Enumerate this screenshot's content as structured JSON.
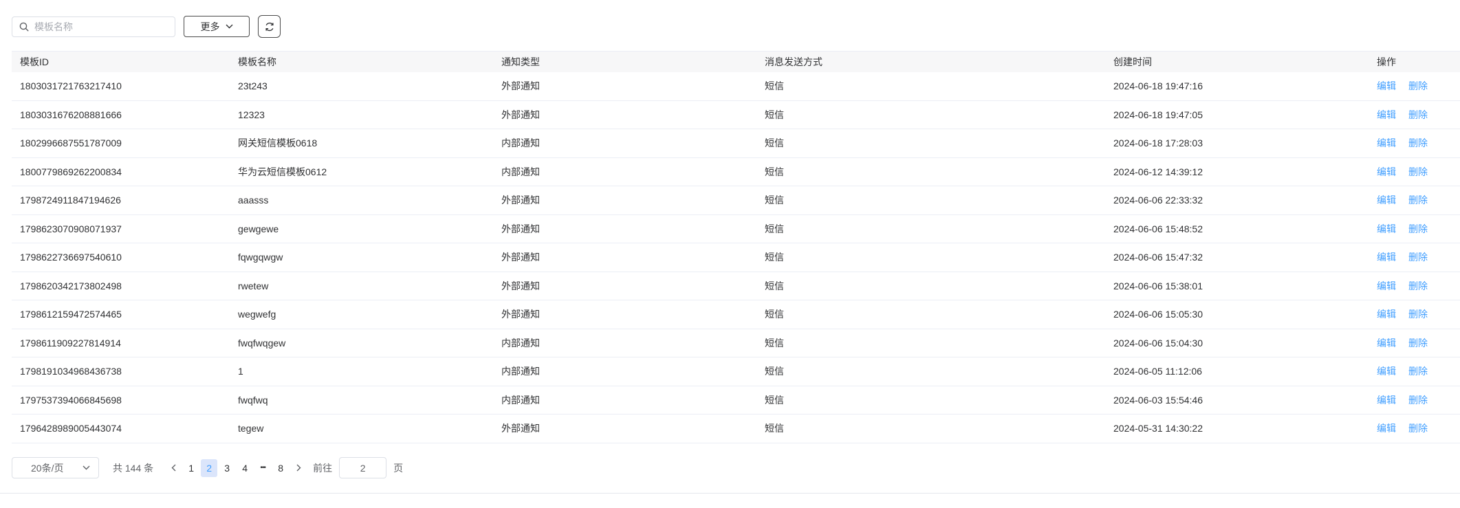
{
  "toolbar": {
    "search_placeholder": "模板名称",
    "more_label": "更多"
  },
  "table": {
    "columns": [
      "模板ID",
      "模板名称",
      "通知类型",
      "消息发送方式",
      "创建时间",
      "操作"
    ],
    "rows": [
      {
        "id": "1803031721763217410",
        "name": "23t243",
        "type": "外部通知",
        "method": "短信",
        "time": "2024-06-18 19:47:16"
      },
      {
        "id": "1803031676208881666",
        "name": "12323",
        "type": "外部通知",
        "method": "短信",
        "time": "2024-06-18 19:47:05"
      },
      {
        "id": "1802996687551787009",
        "name": "网关短信模板0618",
        "type": "内部通知",
        "method": "短信",
        "time": "2024-06-18 17:28:03"
      },
      {
        "id": "1800779869262200834",
        "name": "华为云短信模板0612",
        "type": "内部通知",
        "method": "短信",
        "time": "2024-06-12 14:39:12"
      },
      {
        "id": "1798724911847194626",
        "name": "aaasss",
        "type": "外部通知",
        "method": "短信",
        "time": "2024-06-06 22:33:32"
      },
      {
        "id": "1798623070908071937",
        "name": "gewgewe",
        "type": "外部通知",
        "method": "短信",
        "time": "2024-06-06 15:48:52"
      },
      {
        "id": "1798622736697540610",
        "name": "fqwgqwgw",
        "type": "外部通知",
        "method": "短信",
        "time": "2024-06-06 15:47:32"
      },
      {
        "id": "1798620342173802498",
        "name": "rwetew",
        "type": "外部通知",
        "method": "短信",
        "time": "2024-06-06 15:38:01"
      },
      {
        "id": "1798612159472574465",
        "name": "wegwefg",
        "type": "外部通知",
        "method": "短信",
        "time": "2024-06-06 15:05:30"
      },
      {
        "id": "1798611909227814914",
        "name": "fwqfwqgew",
        "type": "内部通知",
        "method": "短信",
        "time": "2024-06-06 15:04:30"
      },
      {
        "id": "1798191034968436738",
        "name": "1",
        "type": "内部通知",
        "method": "短信",
        "time": "2024-06-05 11:12:06"
      },
      {
        "id": "1797537394066845698",
        "name": "fwqfwq",
        "type": "内部通知",
        "method": "短信",
        "time": "2024-06-03 15:54:46"
      },
      {
        "id": "1796428989005443074",
        "name": "tegew",
        "type": "外部通知",
        "method": "短信",
        "time": "2024-05-31 14:30:22"
      }
    ],
    "edit_label": "编辑",
    "delete_label": "删除"
  },
  "pagination": {
    "page_size_label": "20条/页",
    "total_label": "共 144 条",
    "pages": [
      "1",
      "2",
      "3",
      "4"
    ],
    "current": "2",
    "ellipsis": "•••",
    "last_page": "8",
    "goto_prefix": "前往",
    "goto_value": "2",
    "goto_suffix": "页"
  },
  "colors": {
    "link": "#409eff",
    "active_page_bg": "#dbe5fb",
    "header_bg": "#f7f7f8"
  }
}
